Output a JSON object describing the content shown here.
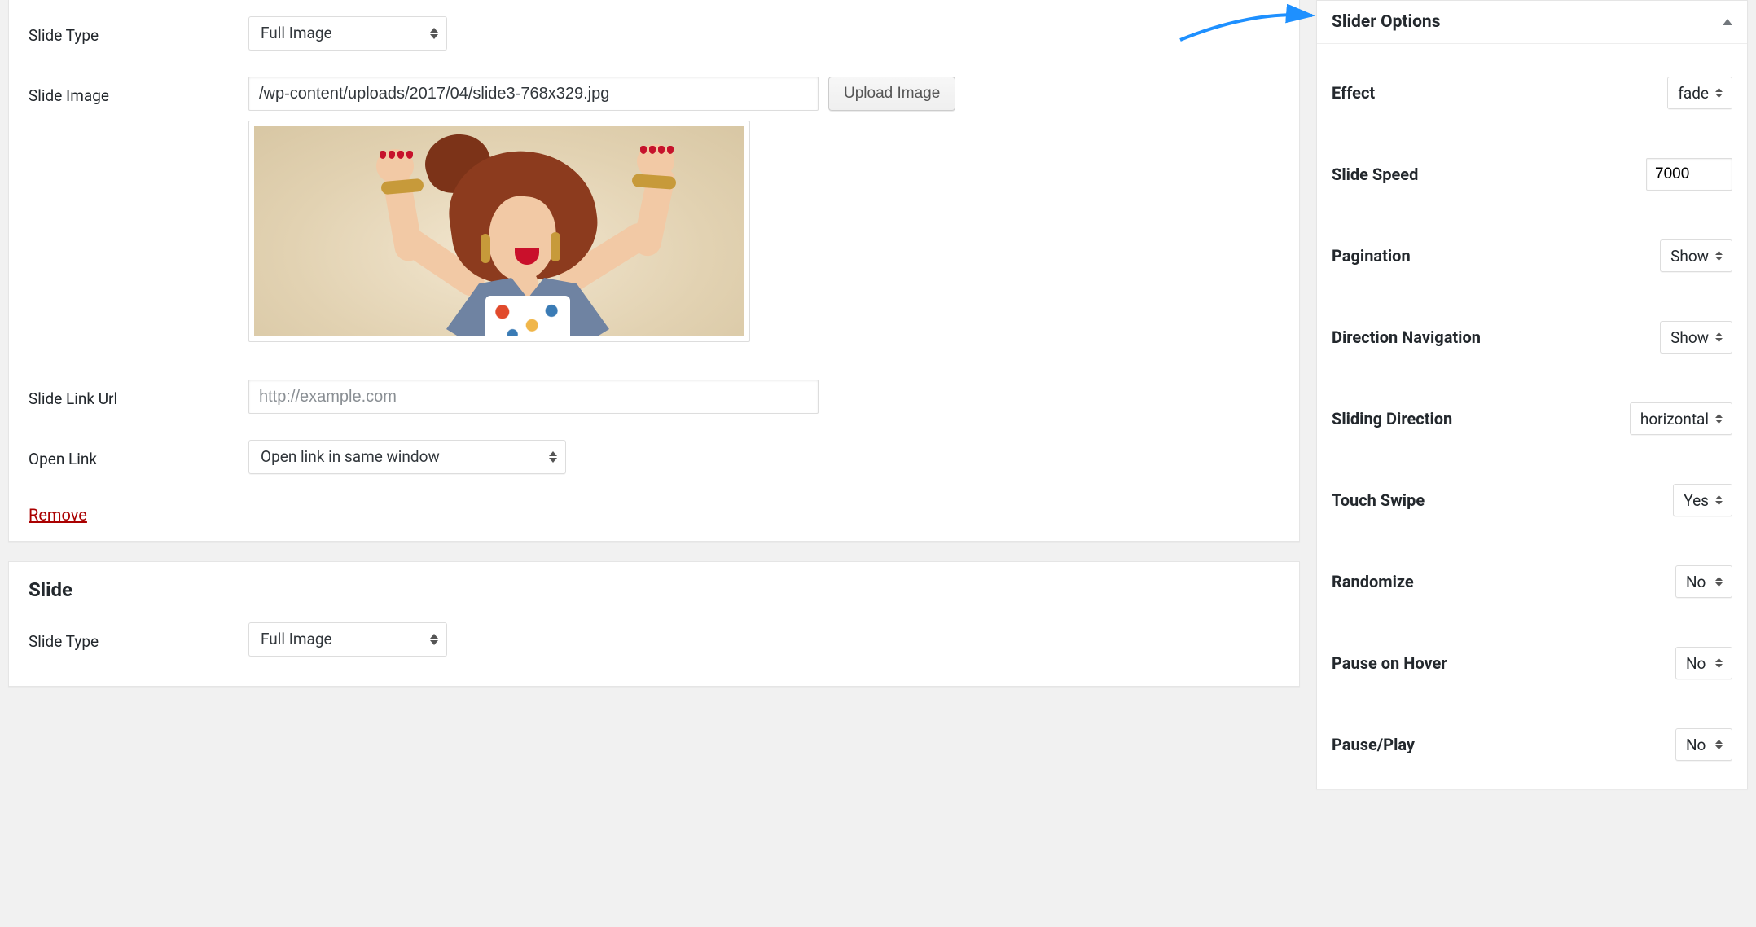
{
  "main": {
    "slide1": {
      "type_label": "Slide Type",
      "type_value": "Full Image",
      "image_label": "Slide Image",
      "image_value": "/wp-content/uploads/2017/04/slide3-768x329.jpg",
      "upload_btn": "Upload Image",
      "link_label": "Slide Link Url",
      "link_placeholder": "http://example.com",
      "open_label": "Open Link",
      "open_value": "Open link in same window",
      "remove": "Remove"
    },
    "slide2": {
      "heading": "Slide",
      "type_label": "Slide Type",
      "type_value": "Full Image"
    }
  },
  "sidebar": {
    "title": "Slider Options",
    "effect_label": "Effect",
    "effect_value": "fade",
    "speed_label": "Slide Speed",
    "speed_value": "7000",
    "pagination_label": "Pagination",
    "pagination_value": "Show",
    "dirnav_label": "Direction Navigation",
    "dirnav_value": "Show",
    "dir_label": "Sliding Direction",
    "dir_value": "horizontal",
    "touch_label": "Touch Swipe",
    "touch_value": "Yes",
    "random_label": "Randomize",
    "random_value": "No",
    "pausehover_label": "Pause on Hover",
    "pausehover_value": "No",
    "pauseplay_label": "Pause/Play",
    "pauseplay_value": "No"
  }
}
